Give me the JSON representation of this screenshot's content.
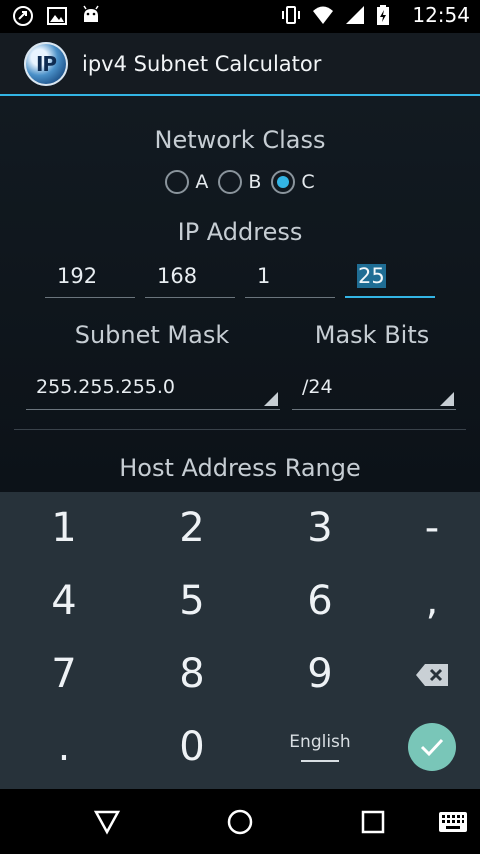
{
  "status_bar": {
    "time": "12:54",
    "left_icons": [
      "sync-icon",
      "image-icon",
      "android-icon"
    ],
    "right_icons": [
      "vibrate-icon",
      "wifi-icon",
      "signal-icon",
      "battery-charging-icon"
    ]
  },
  "app": {
    "title": "ipv4 Subnet Calculator",
    "logo_text": "IP",
    "accent_color": "#33b5e5"
  },
  "network_class": {
    "label": "Network Class",
    "options": [
      "A",
      "B",
      "C"
    ],
    "selected": "C"
  },
  "ip_address": {
    "label": "IP Address",
    "octets": [
      "192",
      "168",
      "1",
      "25"
    ]
  },
  "subnet_mask": {
    "label": "Subnet Mask",
    "value": "255.255.255.0"
  },
  "mask_bits": {
    "label": "Mask Bits",
    "value": "/24"
  },
  "host_range": {
    "label": "Host Address Range"
  },
  "keyboard": {
    "rows": [
      [
        "1",
        "2",
        "3",
        "-"
      ],
      [
        "4",
        "5",
        "6",
        ","
      ],
      [
        "7",
        "8",
        "9"
      ],
      [
        ".",
        "0"
      ]
    ],
    "language_label": "English",
    "backspace_icon": "backspace-icon",
    "done_icon": "checkmark-icon"
  },
  "nav_bar": {
    "icons": [
      "back-icon",
      "home-icon",
      "recents-icon",
      "keyboard-switch-icon"
    ]
  }
}
